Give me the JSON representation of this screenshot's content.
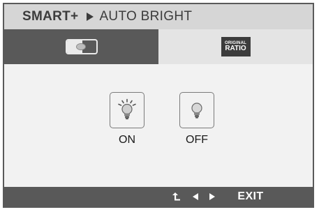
{
  "header": {
    "menu_label": "SMART+",
    "submenu_label": "AUTO BRIGHT"
  },
  "tabs": [
    {
      "name": "auto-bright",
      "icon": "auto-bright-icon",
      "active": true
    },
    {
      "name": "original-ratio",
      "icon": "original-ratio-icon",
      "line1": "ORIGINAL",
      "line2": "RATIO",
      "active": false
    }
  ],
  "options": [
    {
      "label": "ON",
      "icon": "lightbulb-on-icon"
    },
    {
      "label": "OFF",
      "icon": "lightbulb-off-icon"
    }
  ],
  "footer": {
    "enter_icon": "enter-icon",
    "left_icon": "arrow-left-icon",
    "right_icon": "arrow-right-icon",
    "exit_label": "EXIT"
  },
  "colors": {
    "panel_gray": "#d6d6d6",
    "dark_bar": "#595959",
    "content_bg": "#f2f2f2",
    "text_dark": "#3c3c3c"
  }
}
